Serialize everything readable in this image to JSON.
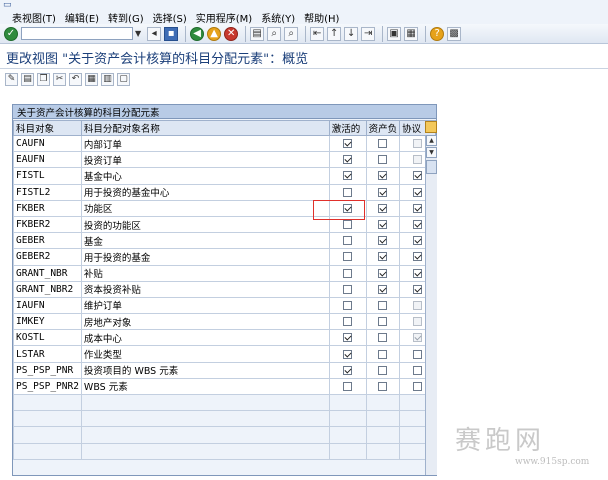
{
  "menu": [
    "表视图(T)",
    "编辑(E)",
    "转到(G)",
    "选择(S)",
    "实用程序(M)",
    "系统(Y)",
    "帮助(H)"
  ],
  "screen_title": "更改视图 \"关于资产会计核算的科目分配元素\"：概览",
  "table": {
    "title": "关于资产会计核算的科目分配元素",
    "columns": [
      "科目对象",
      "科目分配对象名称",
      "激活的",
      "资产负",
      "协议"
    ],
    "rows": [
      {
        "code": "CAUFN",
        "name": "内部订单",
        "active": true,
        "asset": false,
        "agreement": false,
        "agreement_disabled": true
      },
      {
        "code": "EAUFN",
        "name": "投资订单",
        "active": true,
        "asset": false,
        "agreement": false,
        "agreement_disabled": true
      },
      {
        "code": "FISTL",
        "name": "基金中心",
        "active": true,
        "asset": true,
        "agreement": true,
        "agreement_disabled": false
      },
      {
        "code": "FISTL2",
        "name": "用于投资的基金中心",
        "active": false,
        "asset": true,
        "agreement": true,
        "agreement_disabled": false
      },
      {
        "code": "FKBER",
        "name": "功能区",
        "active": true,
        "asset": true,
        "agreement": true,
        "agreement_disabled": false
      },
      {
        "code": "FKBER2",
        "name": "投资的功能区",
        "active": false,
        "asset": true,
        "agreement": true,
        "agreement_disabled": false
      },
      {
        "code": "GEBER",
        "name": "基金",
        "active": false,
        "asset": true,
        "agreement": true,
        "agreement_disabled": false
      },
      {
        "code": "GEBER2",
        "name": "用于投资的基金",
        "active": false,
        "asset": true,
        "agreement": true,
        "agreement_disabled": false
      },
      {
        "code": "GRANT_NBR",
        "name": "补贴",
        "active": false,
        "asset": true,
        "agreement": true,
        "agreement_disabled": false
      },
      {
        "code": "GRANT_NBR2",
        "name": "资本投资补贴",
        "active": false,
        "asset": true,
        "agreement": true,
        "agreement_disabled": false
      },
      {
        "code": "IAUFN",
        "name": "维护订单",
        "active": false,
        "asset": false,
        "agreement": false,
        "agreement_disabled": true
      },
      {
        "code": "IMKEY",
        "name": "房地产对象",
        "active": false,
        "asset": false,
        "agreement": false,
        "agreement_disabled": true
      },
      {
        "code": "KOSTL",
        "name": "成本中心",
        "active": true,
        "asset": false,
        "agreement": true,
        "agreement_disabled": true
      },
      {
        "code": "LSTAR",
        "name": "作业类型",
        "active": true,
        "asset": false,
        "agreement": false,
        "agreement_disabled": false
      },
      {
        "code": "PS_PSP_PNR",
        "name": "投资项目的 WBS 元素",
        "active": true,
        "asset": false,
        "agreement": false,
        "agreement_disabled": false
      },
      {
        "code": "PS_PSP_PNR2",
        "name": "WBS 元素",
        "active": false,
        "asset": false,
        "agreement": false,
        "agreement_disabled": false
      }
    ],
    "empty_rows": 4
  },
  "watermark": {
    "main": "赛跑网",
    "url": "www.915sp.com"
  },
  "colors": {
    "panel_header": "#b8cbe6",
    "title_text": "#1b3f7a",
    "highlight": "#e0302b"
  }
}
